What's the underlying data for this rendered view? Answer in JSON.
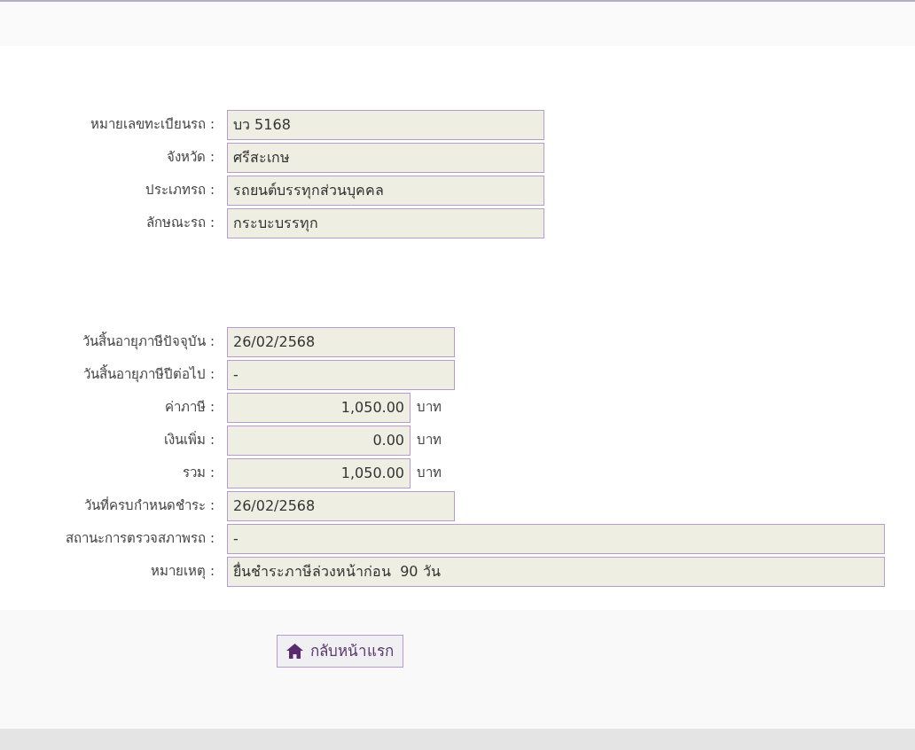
{
  "vehicle": [
    {
      "label": "หมายเลขทะเบียนรถ :",
      "value": "บว 5168",
      "kind": "wide"
    },
    {
      "label": "จังหวัด :",
      "value": "ศรีสะเกษ",
      "kind": "wide"
    },
    {
      "label": "ประเภทรถ :",
      "value": "รถยนต์บรรทุกส่วนบุคคล",
      "kind": "wide"
    },
    {
      "label": "ลักษณะรถ :",
      "value": "กระบะบรรทุก",
      "kind": "wide"
    }
  ],
  "tax": [
    {
      "label": "วันสิ้นอายุภาษีปัจจุบัน :",
      "value": "26/02/2568",
      "kind": "date"
    },
    {
      "label": "วันสิ้นอายุภาษีปีต่อไป :",
      "value": "-",
      "kind": "date"
    },
    {
      "label": "ค่าภาษี :",
      "value": "1,050.00",
      "kind": "money",
      "unit": "บาท"
    },
    {
      "label": "เงินเพิ่ม :",
      "value": "0.00",
      "kind": "money",
      "unit": "บาท"
    },
    {
      "label": "รวม :",
      "value": "1,050.00",
      "kind": "money",
      "unit": "บาท"
    },
    {
      "label": "วันที่ครบกำหนดชำระ :",
      "value": "26/02/2568",
      "kind": "date"
    },
    {
      "label": "สถานะการตรวจสภาพรถ :",
      "value": "-",
      "kind": "long"
    },
    {
      "label": "หมายเหตุ :",
      "value": "ยื่นชำระภาษีล่วงหน้าก่อน  90 วัน",
      "kind": "long"
    }
  ],
  "home_button": {
    "label": "กลับหน้าแรก"
  }
}
